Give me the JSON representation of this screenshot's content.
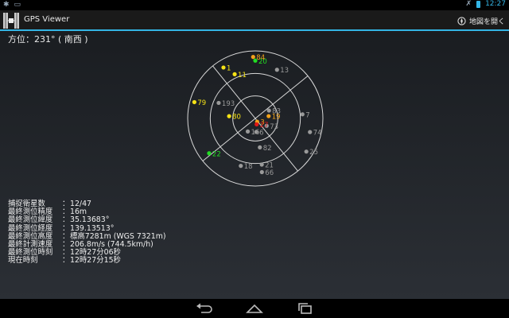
{
  "status_bar": {
    "left_icons": [
      "android-debug-icon",
      "image-notification-icon"
    ],
    "right_icons": [
      "bluetooth-off-icon",
      "battery-icon"
    ],
    "time": "12:27"
  },
  "action_bar": {
    "title": "GPS Viewer",
    "map_button_label": "地図を開く"
  },
  "heading": "方位：231° ( 南西 )",
  "skyplot": {
    "rotation_deg": 231,
    "colors": {
      "yellow": "#f5e216",
      "green": "#22dd22",
      "orange": "#f2a21a",
      "red": "#e01818",
      "gray": "#9a9a9a",
      "ring": "#d8d8d8"
    },
    "satellites": [
      {
        "prn": "20",
        "color": "green",
        "elev": 13,
        "azi": 0
      },
      {
        "prn": "84",
        "color": "orange",
        "elev": 8,
        "azi": -2
      },
      {
        "prn": "1",
        "color": "yellow",
        "elev": 10,
        "azi": -32
      },
      {
        "prn": "11",
        "color": "yellow",
        "elev": 25,
        "azi": -25
      },
      {
        "prn": "13",
        "color": "gray",
        "elev": 19,
        "azi": 24
      },
      {
        "prn": "193",
        "color": "gray",
        "elev": 37,
        "azi": -67
      },
      {
        "prn": "79",
        "color": "yellow",
        "elev": 6,
        "azi": -75
      },
      {
        "prn": "80",
        "color": "yellow",
        "elev": 55,
        "azi": -85
      },
      {
        "prn": "83",
        "color": "gray",
        "elev": 69,
        "azi": 60
      },
      {
        "prn": "19",
        "color": "orange",
        "elev": 72,
        "azi": 80
      },
      {
        "prn": "73",
        "color": "gray",
        "elev": 72,
        "azi": 123
      },
      {
        "prn": "7",
        "color": "gray",
        "elev": 27,
        "azi": 85
      },
      {
        "prn": "74",
        "color": "gray",
        "elev": 15,
        "azi": 104
      },
      {
        "prn": "3",
        "color": "orange",
        "elev": 85,
        "azi": 150
      },
      {
        "prn": "27",
        "color": "red",
        "elev": 82,
        "azi": 167
      },
      {
        "prn": "16",
        "color": "gray",
        "elev": 70,
        "azi": -150
      },
      {
        "prn": "6",
        "color": "gray",
        "elev": 72,
        "azi": 176
      },
      {
        "prn": "82",
        "color": "gray",
        "elev": 51,
        "azi": 171
      },
      {
        "prn": "22",
        "color": "green",
        "elev": 13,
        "azi": -127
      },
      {
        "prn": "25",
        "color": "gray",
        "elev": 9,
        "azi": 123
      },
      {
        "prn": "18",
        "color": "gray",
        "elev": 24,
        "azi": -163
      },
      {
        "prn": "21",
        "color": "gray",
        "elev": 28,
        "azi": 172
      },
      {
        "prn": "66",
        "color": "gray",
        "elev": 18,
        "azi": 173
      }
    ]
  },
  "info": [
    {
      "key": "捕捉衛星数",
      "sep": "：",
      "value": "12/47"
    },
    {
      "key": "最終測位精度",
      "sep": "：",
      "value": "16m"
    },
    {
      "key": "最終測位緯度",
      "sep": "：",
      "value": " 35.13683°"
    },
    {
      "key": "最終測位経度",
      "sep": "：",
      "value": "139.13513°"
    },
    {
      "key": "最終測位高度",
      "sep": "：",
      "value": "標高7281m (WGS 7321m)"
    },
    {
      "key": "最終計測速度",
      "sep": "：",
      "value": "206.8m/s (744.5km/h)"
    },
    {
      "key": "最終測位時刻",
      "sep": "：",
      "value": "12時27分06秒"
    },
    {
      "key": "現在時刻",
      "sep": "：",
      "value": "12時27分15秒"
    }
  ],
  "nav_bar": {
    "buttons": [
      "back-icon",
      "home-icon",
      "recent-apps-icon"
    ]
  }
}
